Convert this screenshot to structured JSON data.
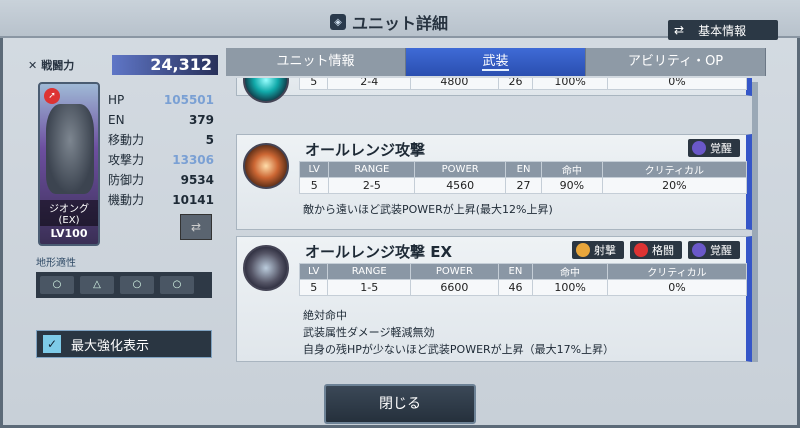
{
  "header": {
    "title": "ユニット詳細",
    "basic_info_label": "基本情報"
  },
  "left": {
    "power_label": "戦闘力",
    "power_value": "24,312",
    "unit_name": "ジオング(EX)",
    "level": "LV100",
    "stats": [
      {
        "label": "HP",
        "value": "105501",
        "boosted": true
      },
      {
        "label": "EN",
        "value": "379",
        "boosted": false
      },
      {
        "label": "移動力",
        "value": "5",
        "boosted": false
      },
      {
        "label": "攻撃力",
        "value": "13306",
        "boosted": true
      },
      {
        "label": "防御力",
        "value": "9534",
        "boosted": false
      },
      {
        "label": "機動力",
        "value": "10141",
        "boosted": false
      }
    ],
    "terrain_title": "地形適性",
    "terrain": [
      "○",
      "△",
      "○",
      "○"
    ],
    "max_enhance_label": "最大強化表示"
  },
  "tabs": [
    {
      "label": "ユニット情報",
      "active": false
    },
    {
      "label": "武装",
      "active": true
    },
    {
      "label": "アビリティ・OP",
      "active": false
    }
  ],
  "table_headers": [
    "LV",
    "RANGE",
    "POWER",
    "EN",
    "命中",
    "クリティカル"
  ],
  "weapons": [
    {
      "name": "",
      "row": [
        "5",
        "2-4",
        "4800",
        "26",
        "100%",
        "0%"
      ],
      "tags": [],
      "desc": []
    },
    {
      "name": "オールレンジ攻撃",
      "row": [
        "5",
        "2-5",
        "4560",
        "27",
        "90%",
        "20%"
      ],
      "tags": [
        "覚醒"
      ],
      "desc": [
        "敵から遠いほど武装POWERが上昇(最大12%上昇)"
      ]
    },
    {
      "name": "オールレンジ攻撃 EX",
      "row": [
        "5",
        "1-5",
        "6600",
        "46",
        "100%",
        "0%"
      ],
      "tags": [
        "射撃",
        "格闘",
        "覚醒"
      ],
      "desc": [
        "絶対命中",
        "武装属性ダメージ軽減無効",
        "自身の残HPが少ないほど武装POWERが上昇（最大17%上昇）"
      ]
    }
  ],
  "close_label": "閉じる"
}
